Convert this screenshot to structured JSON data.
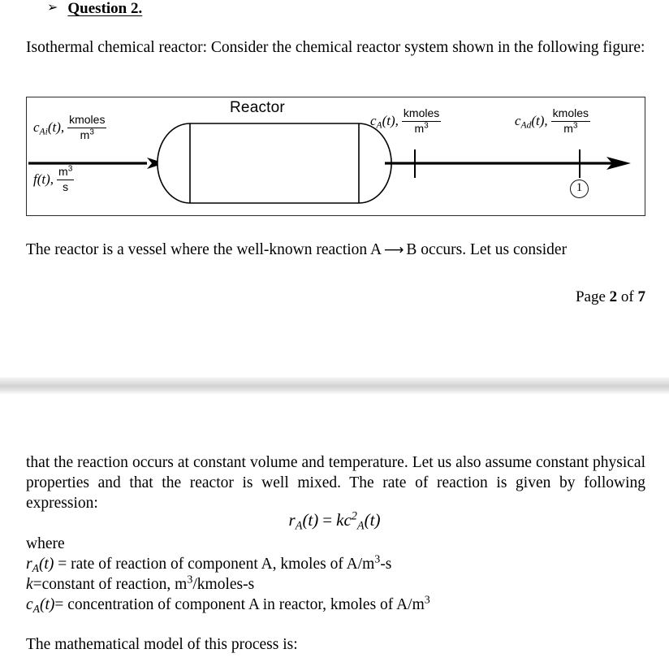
{
  "heading": {
    "bullet": "➢",
    "title": "Question 2."
  },
  "intro": {
    "text": "Isothermal chemical reactor: Consider the chemical reactor system shown in the following figure:"
  },
  "figure": {
    "title": "Reactor",
    "inlet_concentration": {
      "symbol": "c",
      "subscript": "Ai",
      "arg": "(t),",
      "unit_num": "kmoles",
      "unit_den": "m",
      "unit_den_exp": "3"
    },
    "inlet_flow": {
      "symbol": "f",
      "arg": "(t),",
      "unit_num": "m",
      "unit_num_exp": "3",
      "unit_den": "s"
    },
    "reactor_concentration": {
      "symbol": "c",
      "subscript": "A",
      "arg": "(t),",
      "unit_num": "kmoles",
      "unit_den": "m",
      "unit_den_exp": "3"
    },
    "downstream_concentration": {
      "symbol": "c",
      "subscript": "Ad",
      "arg": "(t),",
      "unit_num": "kmoles",
      "unit_den": "m",
      "unit_den_exp": "3"
    },
    "stream_marker": "1"
  },
  "reaction": {
    "before_arrow": "The reactor is a vessel where the well-known reaction A",
    "arrow": "⟶",
    "after_arrow": "B occurs. Let us consider"
  },
  "footer": {
    "prefix": "Page",
    "page": "2",
    "middle": "of",
    "total": "7"
  },
  "continuation": {
    "text": "that the reaction occurs at constant volume and temperature. Let us also assume constant physical properties and that the reactor is well mixed. The rate of reaction is given by following expression:"
  },
  "equation": {
    "lhs_symbol": "r",
    "lhs_sub": "A",
    "lhs_arg": "(t)",
    "equals": "=",
    "rhs_k": "k",
    "rhs_c": "c",
    "rhs_exp": "2",
    "rhs_sub": "A",
    "rhs_arg": "(t)"
  },
  "where_label": "where",
  "definitions": {
    "rate": {
      "symbol": "r",
      "sub": "A",
      "arg": "(t)",
      "text": " = rate of reaction of component A, kmoles of A/m",
      "exp": "3",
      "tail": "-s"
    },
    "constant": {
      "symbol": "k",
      "text": "=constant of reaction, m",
      "exp": "3",
      "tail": "/kmoles-s"
    },
    "concentration": {
      "symbol": "c",
      "sub": "A",
      "arg": "(t)",
      "text": "= concentration of component A in reactor, kmoles of A/m",
      "exp": "3",
      "tail": ""
    }
  },
  "model": {
    "text": "The mathematical model of this process is:"
  },
  "colors": {
    "text": "#000000",
    "figure_border": "#2b2b2b",
    "separator_mid": "#d2d2d2",
    "page_background": "#ffffff"
  }
}
